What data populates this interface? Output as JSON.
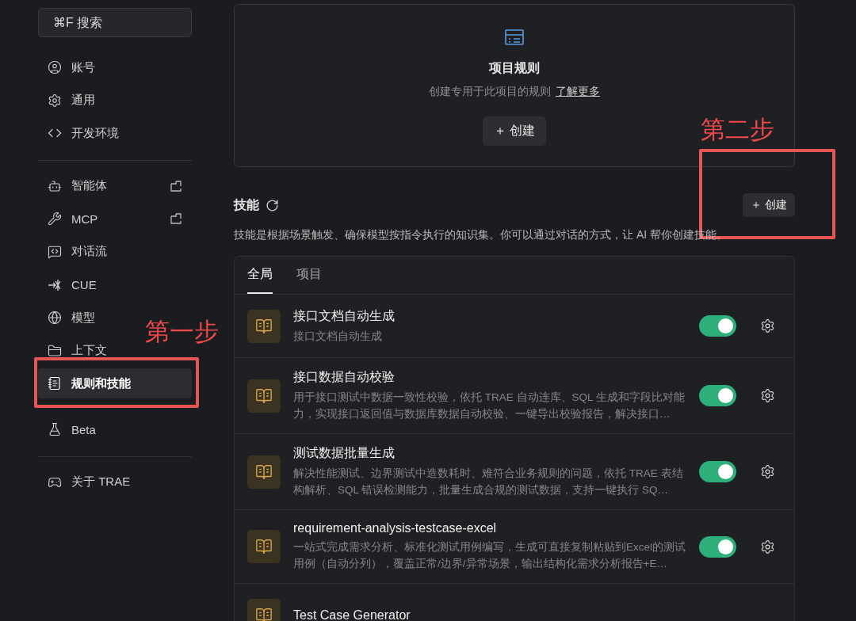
{
  "sidebar": {
    "search": {
      "placeholder": "⌘F 搜索"
    },
    "groups": [
      {
        "items": [
          {
            "kind": "account",
            "label": "账号",
            "selected": false,
            "external": false
          },
          {
            "kind": "general",
            "label": "通用",
            "selected": false,
            "external": false
          },
          {
            "kind": "dev",
            "label": "开发环境",
            "selected": false,
            "external": false
          }
        ]
      },
      {
        "items": [
          {
            "kind": "agent",
            "label": "智能体",
            "selected": false,
            "external": true
          },
          {
            "kind": "mcp",
            "label": "MCP",
            "selected": false,
            "external": true
          },
          {
            "kind": "chat",
            "label": "对话流",
            "selected": false,
            "external": false
          },
          {
            "kind": "cue",
            "label": "CUE",
            "selected": false,
            "external": false
          },
          {
            "kind": "model",
            "label": "模型",
            "selected": false,
            "external": false
          },
          {
            "kind": "context",
            "label": "上下文",
            "selected": false,
            "external": false
          },
          {
            "kind": "rules",
            "label": "规则和技能",
            "selected": true,
            "external": false
          },
          {
            "kind": "beta",
            "label": "Beta",
            "selected": false,
            "external": false
          }
        ]
      },
      {
        "items": [
          {
            "kind": "about",
            "label": "关于 TRAE",
            "selected": false,
            "external": false
          }
        ]
      }
    ]
  },
  "project_rules": {
    "title": "项目规则",
    "description": "创建专用于此项目的规则",
    "link": "了解更多",
    "button": "＋ 创建"
  },
  "skills": {
    "title": "技能",
    "button": "＋ 创建",
    "description": "技能是根据场景触发、确保模型按指令执行的知识集。你可以通过对话的方式，让 AI 帮你创建技能。",
    "tabs": [
      {
        "label": "全局",
        "selected": true
      },
      {
        "label": "项目",
        "selected": false
      }
    ],
    "items": [
      {
        "name": "接口文档自动生成",
        "description": "接口文档自动生成",
        "on": true
      },
      {
        "name": "接口数据自动校验",
        "description": "用于接口测试中数据一致性校验，依托 TRAE 自动连库、SQL 生成和字段比对能力，实现接口返回值与数据库数据自动校验、一键导出校验报告，解决接口…",
        "on": true
      },
      {
        "name": "测试数据批量生成",
        "description": "解决性能测试、边界测试中造数耗时、难符合业务规则的问题，依托 TRAE 表结构解析、SQL 错误检测能力，批量生成合规的测试数据，支持一键执行 SQ…",
        "on": true
      },
      {
        "name": "requirement-analysis-testcase-excel",
        "description": "一站式完成需求分析、标准化测试用例编写，生成可直接复制粘贴到Excel的测试用例（自动分列），覆盖正常/边界/异常场景，输出结构化需求分析报告+E…",
        "on": true
      },
      {
        "name": "Test Case Generator"
      }
    ]
  },
  "annotations": [
    {
      "text": "第一步"
    },
    {
      "text": "第二步"
    }
  ]
}
